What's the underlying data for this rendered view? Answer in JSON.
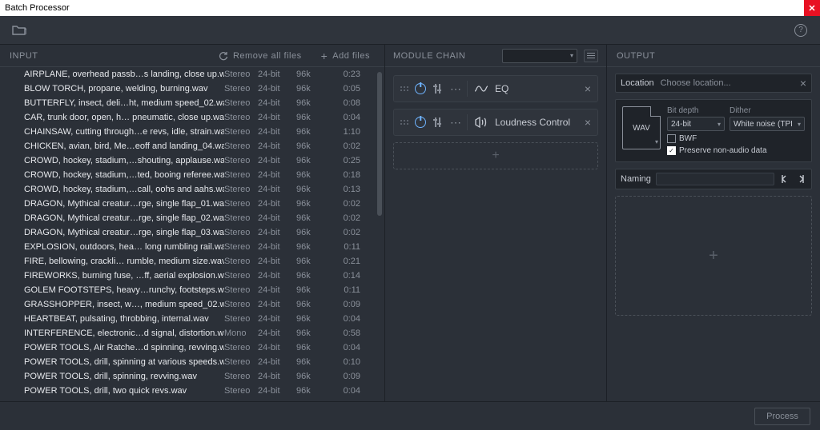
{
  "window": {
    "title": "Batch Processor"
  },
  "panels": {
    "input": {
      "title": "INPUT",
      "remove_all": "Remove all files",
      "add_files": "Add files",
      "files": [
        {
          "name": "AIRPLANE, overhead passb…s landing, close up.wav",
          "ch": "Stereo",
          "bit": "24-bit",
          "rate": "96k",
          "dur": "0:23"
        },
        {
          "name": "BLOW TORCH, propane, welding, burning.wav",
          "ch": "Stereo",
          "bit": "24-bit",
          "rate": "96k",
          "dur": "0:05"
        },
        {
          "name": "BUTTERFLY, insect, deli…ht, medium speed_02.wav",
          "ch": "Stereo",
          "bit": "24-bit",
          "rate": "96k",
          "dur": "0:08"
        },
        {
          "name": "CAR, trunk door, open, h… pneumatic, close up.wav",
          "ch": "Stereo",
          "bit": "24-bit",
          "rate": "96k",
          "dur": "0:04"
        },
        {
          "name": "CHAINSAW, cutting through…e revs, idle, strain.wav",
          "ch": "Stereo",
          "bit": "24-bit",
          "rate": "96k",
          "dur": "1:10"
        },
        {
          "name": "CHICKEN, avian, bird, Me…eoff and landing_04.wav",
          "ch": "Stereo",
          "bit": "24-bit",
          "rate": "96k",
          "dur": "0:02"
        },
        {
          "name": "CROWD, hockey, stadium,…shouting, applause.wav",
          "ch": "Stereo",
          "bit": "24-bit",
          "rate": "96k",
          "dur": "0:25"
        },
        {
          "name": "CROWD, hockey, stadium,…ted, booing referee.wav",
          "ch": "Stereo",
          "bit": "24-bit",
          "rate": "96k",
          "dur": "0:18"
        },
        {
          "name": "CROWD, hockey, stadium,…call, oohs and aahs.wav",
          "ch": "Stereo",
          "bit": "24-bit",
          "rate": "96k",
          "dur": "0:13"
        },
        {
          "name": "DRAGON, Mythical creatur…rge, single flap_01.wav",
          "ch": "Stereo",
          "bit": "24-bit",
          "rate": "96k",
          "dur": "0:02"
        },
        {
          "name": "DRAGON, Mythical creatur…rge, single flap_02.wav",
          "ch": "Stereo",
          "bit": "24-bit",
          "rate": "96k",
          "dur": "0:02"
        },
        {
          "name": "DRAGON, Mythical creatur…rge, single flap_03.wav",
          "ch": "Stereo",
          "bit": "24-bit",
          "rate": "96k",
          "dur": "0:02"
        },
        {
          "name": "EXPLOSION, outdoors, hea… long rumbling rail.wav",
          "ch": "Stereo",
          "bit": "24-bit",
          "rate": "96k",
          "dur": "0:11"
        },
        {
          "name": "FIRE, bellowing, crackli… rumble, medium size.wav",
          "ch": "Stereo",
          "bit": "24-bit",
          "rate": "96k",
          "dur": "0:21"
        },
        {
          "name": "FIREWORKS, burning fuse, …ff, aerial explosion.wav",
          "ch": "Stereo",
          "bit": "24-bit",
          "rate": "96k",
          "dur": "0:14"
        },
        {
          "name": "GOLEM FOOTSTEPS, heavy…runchy, footsteps.wav",
          "ch": "Stereo",
          "bit": "24-bit",
          "rate": "96k",
          "dur": "0:11"
        },
        {
          "name": "GRASSHOPPER, insect, w…, medium speed_02.wav",
          "ch": "Stereo",
          "bit": "24-bit",
          "rate": "96k",
          "dur": "0:09"
        },
        {
          "name": "HEARTBEAT, pulsating, throbbing, internal.wav",
          "ch": "Stereo",
          "bit": "24-bit",
          "rate": "96k",
          "dur": "0:04"
        },
        {
          "name": "INTERFERENCE, electronic…d signal, distortion.wav",
          "ch": "Mono",
          "bit": "24-bit",
          "rate": "96k",
          "dur": "0:58"
        },
        {
          "name": "POWER TOOLS, Air Ratche…d spinning, revving.wav",
          "ch": "Stereo",
          "bit": "24-bit",
          "rate": "96k",
          "dur": "0:04"
        },
        {
          "name": "POWER TOOLS, drill, spinning at various speeds.wav",
          "ch": "Stereo",
          "bit": "24-bit",
          "rate": "96k",
          "dur": "0:10"
        },
        {
          "name": "POWER TOOLS, drill, spinning, revving.wav",
          "ch": "Stereo",
          "bit": "24-bit",
          "rate": "96k",
          "dur": "0:09"
        },
        {
          "name": "POWER TOOLS, drill, two quick revs.wav",
          "ch": "Stereo",
          "bit": "24-bit",
          "rate": "96k",
          "dur": "0:04"
        }
      ]
    },
    "chain": {
      "title": "MODULE CHAIN",
      "modules": [
        {
          "name": "EQ"
        },
        {
          "name": "Loudness Control"
        }
      ]
    },
    "output": {
      "title": "OUTPUT",
      "location_label": "Location",
      "location_value": "Choose location...",
      "format": {
        "container": "WAV",
        "bit_depth_label": "Bit depth",
        "bit_depth_value": "24-bit",
        "dither_label": "Dither",
        "dither_value": "White noise (TPI",
        "bwf_label": "BWF",
        "bwf_checked": false,
        "preserve_label": "Preserve non-audio data",
        "preserve_checked": true
      },
      "naming_label": "Naming"
    }
  },
  "actions": {
    "process": "Process"
  }
}
